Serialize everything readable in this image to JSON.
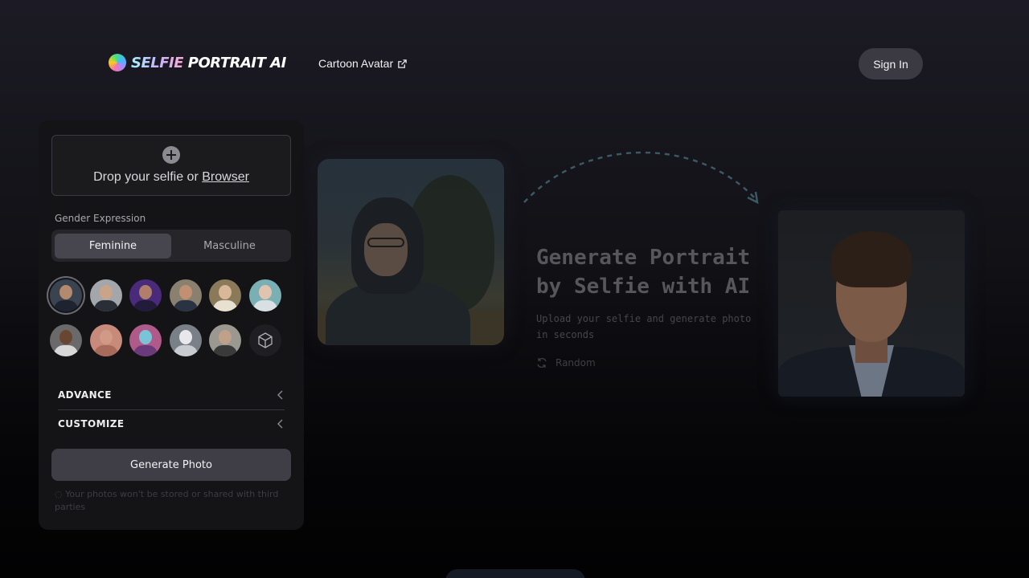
{
  "header": {
    "logo_part1": "SELFIE",
    "logo_part2": " PORTRAIT AI",
    "nav_link": "Cartoon Avatar",
    "signin_label": "Sign In"
  },
  "upload": {
    "drop_text": "Drop your selfie or ",
    "browse_label": "Browser"
  },
  "gender": {
    "label": "Gender Expression",
    "options": [
      "Feminine",
      "Masculine"
    ],
    "selected": "Feminine"
  },
  "styles": {
    "colors": [
      {
        "bg": "#3a4350",
        "head": "#b48a6e",
        "body": "#1d2430"
      },
      {
        "bg": "#a3a7ab",
        "head": "#c9a488",
        "body": "#2a2e36"
      },
      {
        "bg": "#4a2a7a",
        "head": "#b07e6a",
        "body": "#221b3a"
      },
      {
        "bg": "#8a8070",
        "head": "#c09070",
        "body": "#2a3344"
      },
      {
        "bg": "#8a7a5a",
        "head": "#d8b898",
        "body": "#e8e0d0"
      },
      {
        "bg": "#7ab0b4",
        "head": "#e0c4b0",
        "body": "#d8e0e4"
      },
      {
        "bg": "#6a6a6a",
        "head": "#6a4632",
        "body": "#d8d8d8"
      },
      {
        "bg": "#c88a7a",
        "head": "#d09a86",
        "body": "#a86a5a"
      },
      {
        "bg": "#b05a8a",
        "head": "#7ac4d8",
        "body": "#6a3a7a"
      },
      {
        "bg": "#7a8088",
        "head": "#e8e8ec",
        "body": "#c8ccd0"
      },
      {
        "bg": "#9a9890",
        "head": "#c0a088",
        "body": "#3a3a3a"
      }
    ]
  },
  "advance_label": "ADVANCE",
  "customize_label": "CUSTOMIZE",
  "generate_label": "Generate Photo",
  "privacy_text": "Your photos won't be stored or shared with third parties",
  "hero": {
    "title_line1": "Generate Portrait",
    "title_line2": "by Selfie with AI",
    "subtitle": "Upload your selfie and generate photo in seconds",
    "random_label": "Random"
  },
  "colors": {
    "accent_arc": "#3c5a66",
    "panel": "#141417",
    "button": "#3f3e46"
  }
}
